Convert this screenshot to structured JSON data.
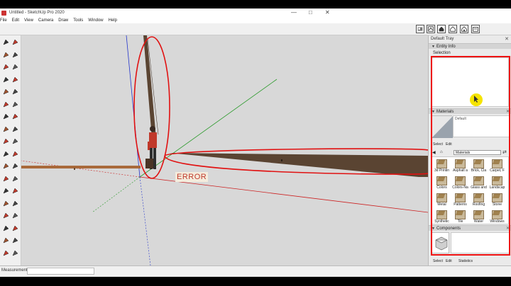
{
  "window": {
    "title": "Untitled - SketchUp Pro 2020",
    "minimize": "—",
    "maximize": "□",
    "close": "✕"
  },
  "menu": [
    "File",
    "Edit",
    "View",
    "Camera",
    "Draw",
    "Tools",
    "Window",
    "Help"
  ],
  "top_toolbar_icons": [
    "warehouse-icon",
    "extension-icon",
    "home-icon",
    "house-icon",
    "house-outline-icon",
    "building-icon"
  ],
  "left_tool_icons": [
    "select-icon",
    "eraser-icon",
    "paint-bucket-icon",
    "line-icon",
    "freehand-icon",
    "rectangle-icon",
    "rotated-rectangle-icon",
    "circle-icon",
    "polygon-icon",
    "arc-icon",
    "two-point-arc-icon",
    "three-point-arc-icon",
    "pie-icon",
    "push-pull-icon",
    "follow-me-icon",
    "offset-icon",
    "move-icon",
    "rotate-icon",
    "scale-icon",
    "tape-measure-icon",
    "dimension-icon",
    "protractor-icon",
    "text-icon",
    "axes-icon",
    "3d-text-icon",
    "orbit-icon",
    "pan-icon",
    "zoom-icon",
    "zoom-window-icon",
    "zoom-extents-icon",
    "position-camera-icon",
    "look-around-icon",
    "walk-icon",
    "section-plane-icon",
    "display-section-icon",
    "sandbox-icon"
  ],
  "viewport": {
    "error_text": "ERROR"
  },
  "status": {
    "measurements_label": "Measurements"
  },
  "tray": {
    "title": "Default Tray",
    "close": "✕",
    "entity_info": {
      "label": "Entity Info",
      "selection": "Selection"
    },
    "materials": {
      "label": "Materials",
      "default_label": "Default",
      "tab_select": "Select",
      "tab_edit": "Edit",
      "search_value": "Materials",
      "items": [
        "3d Printin",
        "Asphalt a",
        "Brick, Cla",
        "Carpet, F",
        "Colors",
        "Colors-Na",
        "Glass and",
        "Landscap",
        "Metal",
        "Patterns",
        "Roofing",
        "Stone",
        "Synthetic",
        "Tile",
        "Water",
        "Windows"
      ]
    },
    "components": {
      "label": "Components",
      "tab_select": "Select",
      "tab_edit": "Edit",
      "tab_statistics": "Statistics"
    }
  },
  "colors": {
    "annotation_red": "#e11111",
    "axis_red": "#cc2222",
    "axis_green": "#2a9a2a",
    "axis_blue": "#2233cc",
    "wood": "#5a4432",
    "canvas_bg": "#d8d8d8"
  }
}
